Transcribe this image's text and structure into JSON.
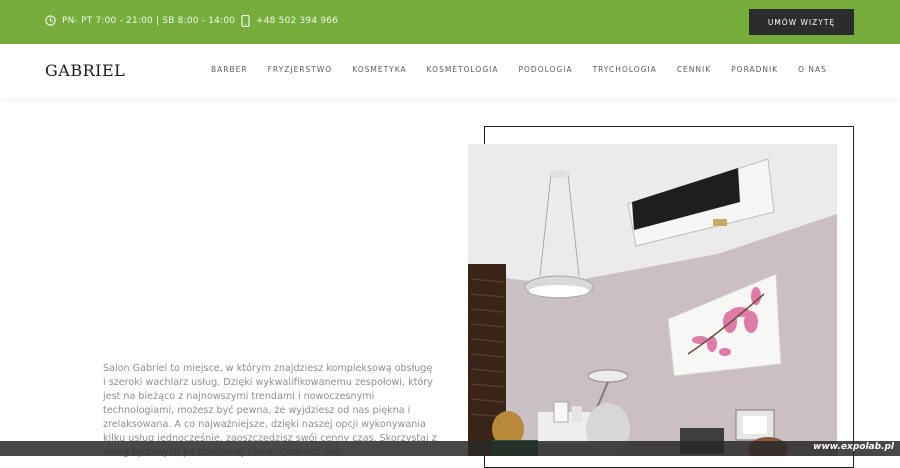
{
  "topbar": {
    "hours_text": "PN- PT 7:00 - 21:00 | SB 8:00 - 14:00",
    "phone_text": "+48 502 394 966",
    "cta_label": "UMÓW WIZYTĘ",
    "hours_icon": "clock-icon",
    "phone_icon": "smartphone-icon",
    "background_color": "#76ad3c"
  },
  "header": {
    "logo_text": "GABRIEL",
    "menu": [
      {
        "label": "BARBER"
      },
      {
        "label": "FRYZJERSTWO"
      },
      {
        "label": "KOSMETYKA"
      },
      {
        "label": "KOSMETOLOGIA"
      },
      {
        "label": "PODOLOGIA"
      },
      {
        "label": "TRYCHOLOGIA"
      },
      {
        "label": "CENNIK"
      },
      {
        "label": "PORADNIK"
      },
      {
        "label": "O NAS"
      }
    ]
  },
  "main": {
    "intro_text": "Salon Gabriel to miejsce, w którym znajdziesz kompleksową obsługę i szeroki wachlarz usług. Dzięki wykwalifikowanemu zespołowi, który jest na bieżąco z najnowszymi trendami i nowoczesnymi technologiami, możesz być pewna, że wyjdziesz od nas piękna i zrelaksowana. A co najważniejsze, dzięki naszej opcji wykonywania kilku usług jednocześnie, zaoszczędzisz swój cenny czas. Skorzystaj z usług łączonych po obniżonej cenie. Odwiedź nas"
  },
  "watermark_text": "www.expolab.pl"
}
